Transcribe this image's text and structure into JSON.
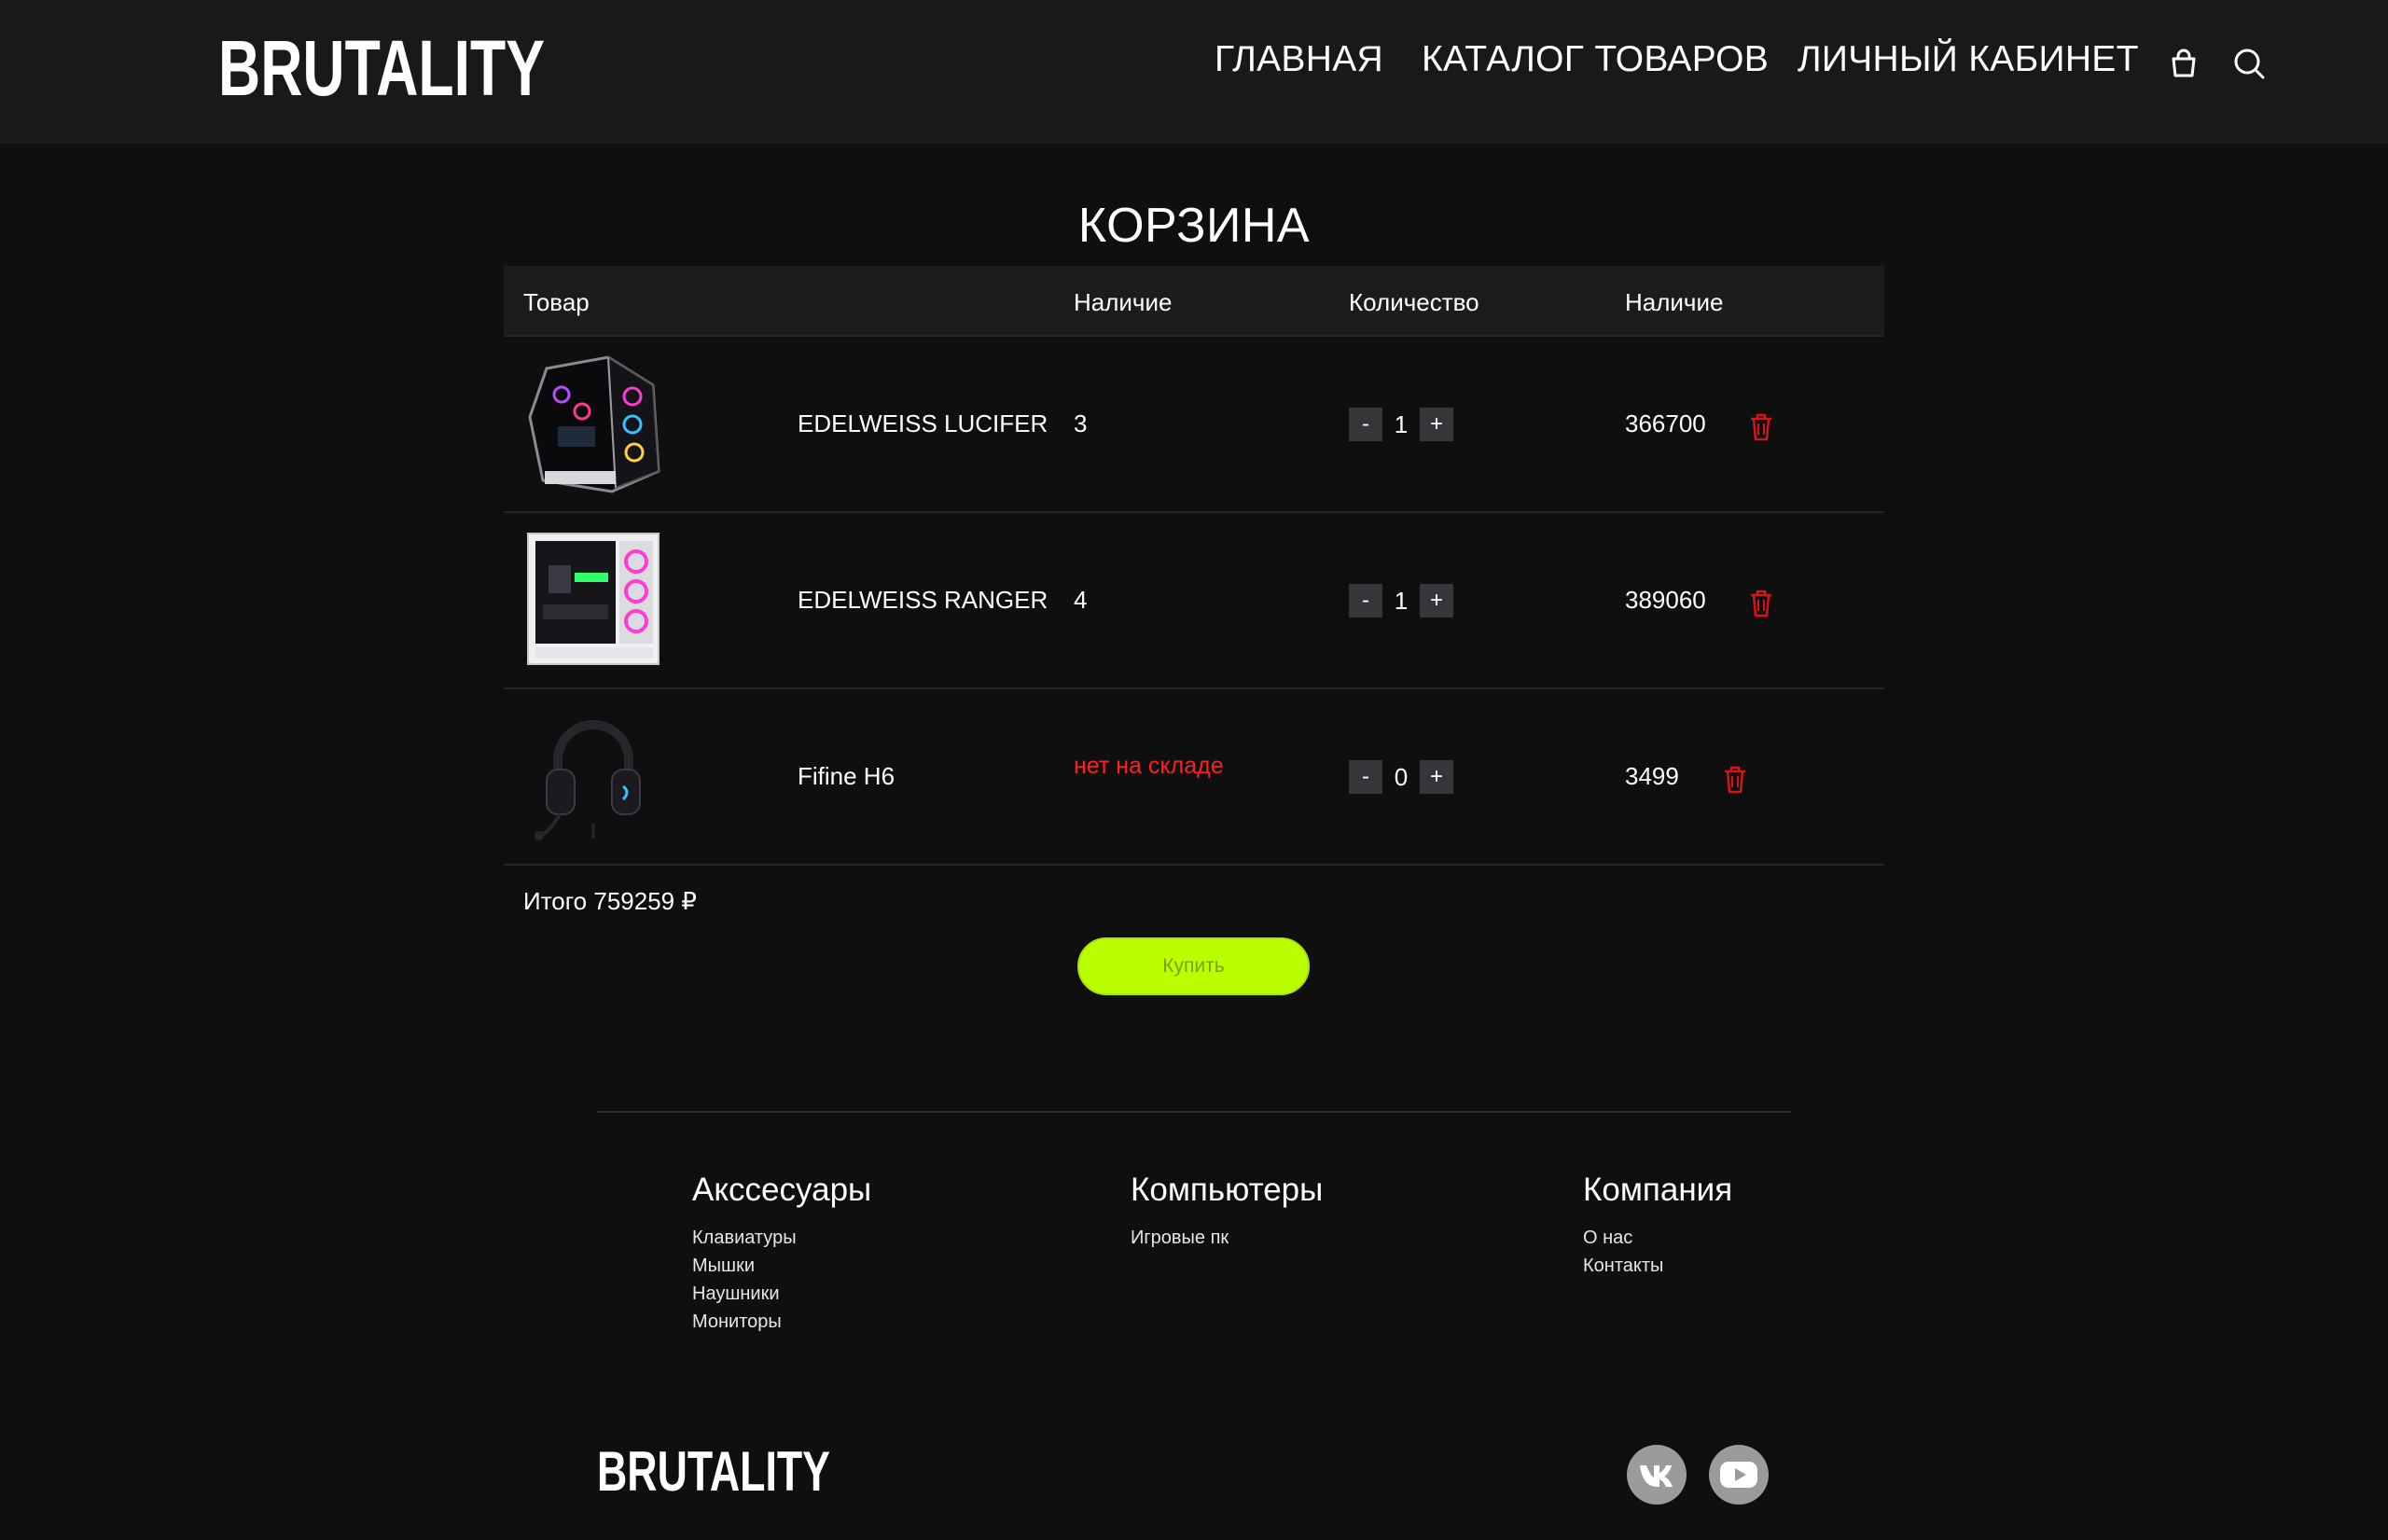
{
  "header": {
    "logo_text": "BRUTALITY",
    "nav": [
      {
        "label": "ГЛАВНАЯ"
      },
      {
        "label": "КАТАЛОГ ТОВАРОВ"
      },
      {
        "label": "ЛИЧНЫЙ КАБИНЕТ"
      }
    ],
    "icons": [
      "cart-icon",
      "search-icon"
    ]
  },
  "cart": {
    "title": "КОРЗИНА",
    "columns": [
      "Товар",
      "Наличие",
      "Количество",
      "Наличие"
    ],
    "items": [
      {
        "name": "EDELWEISS LUCIFER",
        "stock": "3",
        "quantity": "1",
        "price": "366700",
        "stock_available": true
      },
      {
        "name": "EDELWEISS RANGER",
        "stock": "4",
        "quantity": "1",
        "price": "389060",
        "stock_available": true
      },
      {
        "name": "Fifine H6",
        "stock": "нет на складе",
        "quantity": "0",
        "price": "3499",
        "stock_available": false
      }
    ],
    "qty_minus": "-",
    "qty_plus": "+",
    "total_label": "Итого 759259 ₽",
    "buy_label": "Купить"
  },
  "footer": {
    "columns": [
      {
        "title": "Акссесуары",
        "links": [
          "Клавиатуры",
          "Мышки",
          "Наушники",
          "Мониторы"
        ]
      },
      {
        "title": "Компьютеры",
        "links": [
          "Игровые пк"
        ]
      },
      {
        "title": "Компания",
        "links": [
          "О нас",
          "Контакты"
        ]
      }
    ],
    "logo_text": "BRUTALITY",
    "social": [
      "vk-icon",
      "youtube-icon"
    ]
  },
  "colors": {
    "accent": "#baff00",
    "danger": "#ff1f1f",
    "background": "#0f0f10",
    "header_bg": "#19191b"
  }
}
